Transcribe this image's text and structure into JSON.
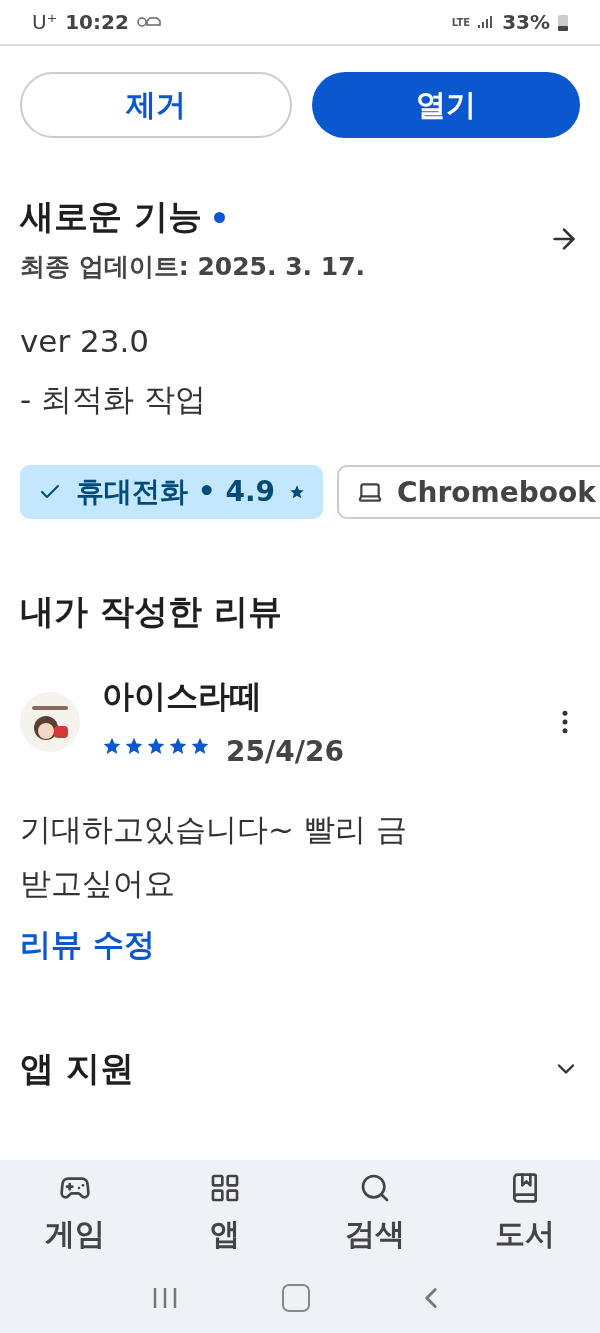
{
  "status_bar": {
    "carrier": "U⁺",
    "time": "10:22",
    "network": "LTE",
    "battery": "33%"
  },
  "actions": [
    {
      "label": "제거",
      "kind": "outline"
    },
    {
      "label": "열기",
      "kind": "filled"
    }
  ],
  "whats_new": {
    "title": "새로운 기능",
    "updated": "최종 업데이트: 2025. 3. 17.",
    "notes": [
      "ver 23.0",
      "- 최적화 작업"
    ]
  },
  "device_chips": [
    {
      "label": "휴대전화 • 4.9",
      "kind": "phone",
      "selected": true
    },
    {
      "label": "Chromebook",
      "kind": "laptop",
      "selected": false
    }
  ],
  "my_review": {
    "title": "내가 작성한 리뷰",
    "author": "아이스라떼",
    "stars": 5,
    "date": "25/4/26",
    "text": "기대하고있습니다~ 빨리 금 받고싶어요",
    "edit_link": "리뷰 수정"
  },
  "app_support": {
    "title": "앱 지원",
    "expanded": false
  },
  "bottom_nav": [
    {
      "label": "게임",
      "kind": "games"
    },
    {
      "label": "앱",
      "kind": "apps"
    },
    {
      "label": "검색",
      "kind": "search"
    },
    {
      "label": "도서",
      "kind": "books"
    }
  ]
}
